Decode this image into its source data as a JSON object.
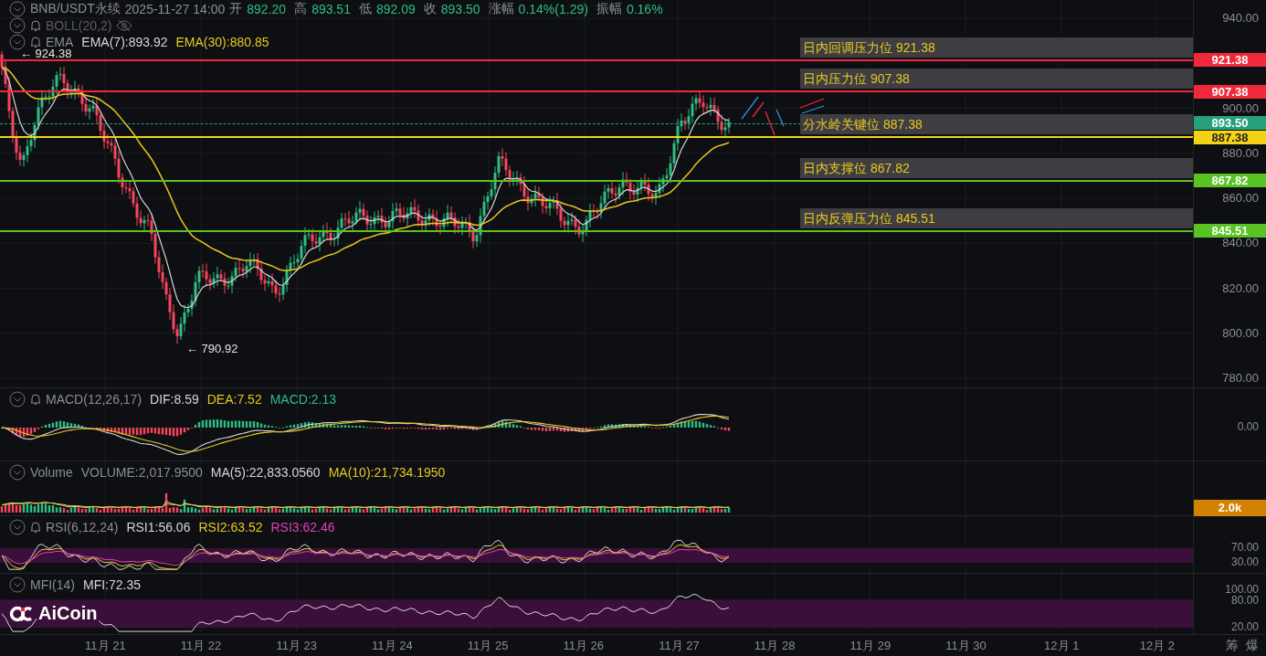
{
  "header": {
    "symbol": "BNB/USDT永续",
    "time": "2025-11-27 14:00",
    "stats": [
      {
        "label": "开",
        "value": "892.20"
      },
      {
        "label": "高",
        "value": "893.51"
      },
      {
        "label": "低",
        "value": "892.09"
      },
      {
        "label": "收",
        "value": "893.50"
      },
      {
        "label": "涨幅",
        "value": "0.14%(1.29)"
      },
      {
        "label": "振幅",
        "value": "0.16%"
      }
    ]
  },
  "main_indicators": [
    {
      "name": "BOLL(20,2)",
      "alert": true,
      "hidden": true
    },
    {
      "name": "EMA",
      "alert": true,
      "hidden": false,
      "values": [
        {
          "text": "EMA(7):893.92",
          "color": "#d6d6d6"
        },
        {
          "text": "EMA(30):880.85",
          "color": "#e8c81f"
        }
      ]
    }
  ],
  "price_marks": [
    {
      "kind": "high",
      "text": "← 924.38"
    },
    {
      "kind": "low",
      "text": "← 790.92"
    }
  ],
  "levels": [
    {
      "label": "日内回调压力位 921.38",
      "price": "921.38",
      "color": "#f0283c"
    },
    {
      "label": "日内压力位 907.38",
      "price": "907.38",
      "color": "#f0283c"
    },
    {
      "label": "分水岭关键位 887.38",
      "price": "887.38",
      "color": "#f2d316"
    },
    {
      "label": "日内支撑位 867.82",
      "price": "867.82",
      "color": "#58c322"
    },
    {
      "label": "日内反弹压力位 845.51",
      "price": "845.51",
      "color": "#58c322"
    }
  ],
  "current_price": "893.50",
  "price_axis": [
    "940.00",
    "900.00",
    "880.00",
    "860.00",
    "840.00",
    "820.00",
    "800.00",
    "780.00"
  ],
  "panels": [
    {
      "kind": "macd",
      "name": "MACD(12,26,17)",
      "alert": true,
      "values": [
        {
          "text": "DIF:8.59",
          "color": "#d6d6d6"
        },
        {
          "text": "DEA:7.52",
          "color": "#e8c81f"
        },
        {
          "text": "MACD:2.13",
          "color": "#2ebd85"
        }
      ],
      "axis": [
        "0.00"
      ]
    },
    {
      "kind": "volume",
      "name": "Volume",
      "alert": false,
      "values": [
        {
          "text": "VOLUME:2,017.9500",
          "color": "#8a8e96"
        },
        {
          "text": "MA(5):22,833.0560",
          "color": "#d6d6d6"
        },
        {
          "text": "MA(10):21,734.1950",
          "color": "#e8c81f"
        }
      ],
      "tag": "2.0k"
    },
    {
      "kind": "rsi",
      "name": "RSI(6,12,24)",
      "alert": true,
      "values": [
        {
          "text": "RSI1:56.06",
          "color": "#d6d6d6"
        },
        {
          "text": "RSI2:63.52",
          "color": "#e8c81f"
        },
        {
          "text": "RSI3:62.46",
          "color": "#e040c0"
        }
      ],
      "axis": [
        "70.00",
        "30.00"
      ]
    },
    {
      "kind": "mfi",
      "name": "MFI(14)",
      "alert": false,
      "values": [
        {
          "text": "MFI:72.35",
          "color": "#d6d6d6"
        }
      ],
      "axis": [
        "100.00",
        "80.00",
        "20.00"
      ]
    }
  ],
  "logo": "AiCoin",
  "time_axis": [
    "11月 21",
    "11月 22",
    "11月 23",
    "11月 24",
    "11月 25",
    "11月 26",
    "11月 27",
    "11月 28",
    "11月 29",
    "11月 30",
    "12月 1",
    "12月 2"
  ],
  "corner_buttons": [
    "筹",
    "爆"
  ]
}
